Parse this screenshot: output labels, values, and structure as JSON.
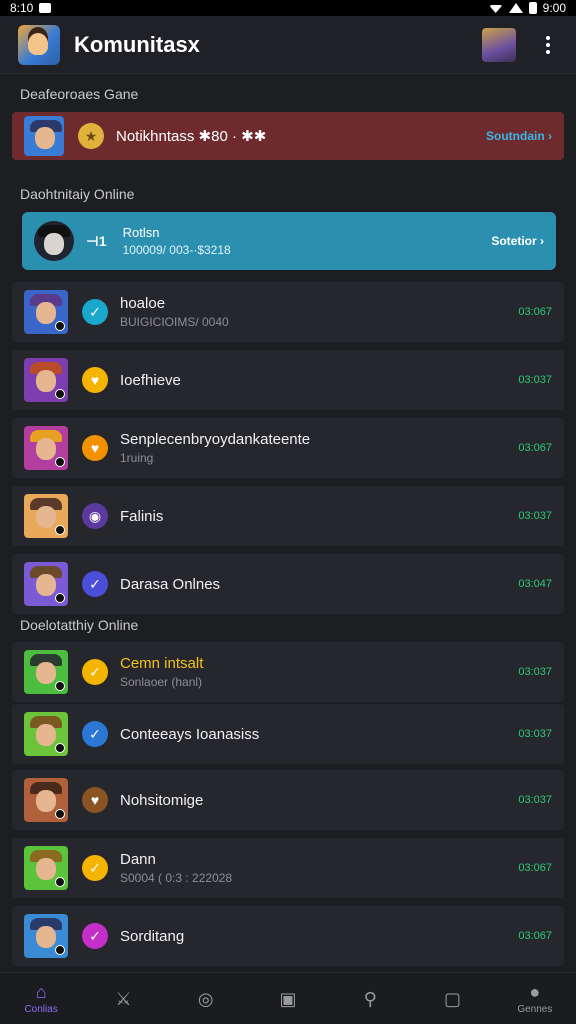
{
  "status": {
    "left": "8:10",
    "right": "9:00"
  },
  "appbar": {
    "title": "Komunitasx",
    "logo_icon": "game-logo-icon",
    "menu_icon": "kebab-menu-icon"
  },
  "sections": {
    "first": "Deafeoroaes Gane",
    "second": "Daohtnitaiy Online",
    "third": "Doelotatthiy Online"
  },
  "notification": {
    "title": "Notikhntass ✱80 · ✱✱",
    "action": "Soutndain ›"
  },
  "online_card": {
    "icon": "⊣1",
    "title": "Rotlsn",
    "sub": "100009/ 003-·$3218",
    "action": "Sotetior ›"
  },
  "list1": [
    {
      "title": "hoaloe",
      "sub": "BUIGICIOIMS/ 0040",
      "time": "03:067",
      "badge_color": "#19a7cc",
      "badge_glyph": "✓",
      "avatar_bg": "#3a66c9",
      "hat_color": "#5a3a8a"
    },
    {
      "title": "Ioefhieve",
      "sub": "",
      "time": "03:037",
      "badge_color": "#f4b400",
      "badge_glyph": "♥",
      "avatar_bg": "#7d3fb0",
      "hat_color": "#b84b2a"
    },
    {
      "title": "Senplecenbryoydankateente",
      "sub": "1ruing",
      "time": "03:067",
      "badge_color": "#f29200",
      "badge_glyph": "♥",
      "avatar_bg": "#b23f9f",
      "hat_color": "#e6a120"
    },
    {
      "title": "Falinis",
      "sub": "",
      "time": "03:037",
      "badge_color": "#5b3a9e",
      "badge_glyph": "◉",
      "avatar_bg": "#e8a95a",
      "hat_color": "#5b3a2a"
    },
    {
      "title": "Darasa Onlnes",
      "sub": "",
      "time": "03:047",
      "badge_color": "#4b4fd8",
      "badge_glyph": "✓",
      "avatar_bg": "#7b5ad6",
      "hat_color": "#6b4a2a"
    }
  ],
  "list2": [
    {
      "title": "Cemn intsalt",
      "title_color": "#f4c21b",
      "sub": "Sonlaoer (hanl)",
      "time": "03:037",
      "badge_color": "#f4b400",
      "badge_glyph": "✓",
      "avatar_bg": "#4cbd3e",
      "hat_color": "#2c3b30"
    },
    {
      "title": "Conteeays Ioanasiss",
      "title_color": "#f1f1f3",
      "sub": "",
      "time": "03:037",
      "badge_color": "#2a77d6",
      "badge_glyph": "✓",
      "avatar_bg": "#6bc43a",
      "hat_color": "#7a5a20"
    },
    {
      "title": "Nohsitomige",
      "title_color": "#f1f1f3",
      "sub": "",
      "time": "03:037",
      "badge_color": "#8a5424",
      "badge_glyph": "♥",
      "avatar_bg": "#b0603a",
      "hat_color": "#4a2a1a"
    },
    {
      "title": "Dann",
      "title_color": "#f1f1f3",
      "sub": "S0004 ( 0:3 : 222028",
      "time": "03:067",
      "badge_color": "#f4b400",
      "badge_glyph": "✓",
      "avatar_bg": "#5cc43a",
      "hat_color": "#8a6a20"
    },
    {
      "title": "Sorditang",
      "title_color": "#f1f1f3",
      "sub": "",
      "time": "03:067",
      "badge_color": "#c42fc9",
      "badge_glyph": "✓",
      "avatar_bg": "#3a8ad6",
      "hat_color": "#2a3a6a"
    }
  ],
  "nav": [
    {
      "icon": "⌂",
      "name": "home-icon",
      "label": "Conlias",
      "active": true
    },
    {
      "icon": "⚔",
      "name": "swords-icon",
      "label": "",
      "active": false
    },
    {
      "icon": "◎",
      "name": "compass-icon",
      "label": "",
      "active": false
    },
    {
      "icon": "▣",
      "name": "square-icon",
      "label": "",
      "active": false
    },
    {
      "icon": "⚲",
      "name": "search-icon",
      "label": "",
      "active": false
    },
    {
      "icon": "▢",
      "name": "chat-icon",
      "label": "",
      "active": false
    },
    {
      "icon": "●",
      "name": "profile-icon",
      "label": "Gennes",
      "active": false
    }
  ]
}
